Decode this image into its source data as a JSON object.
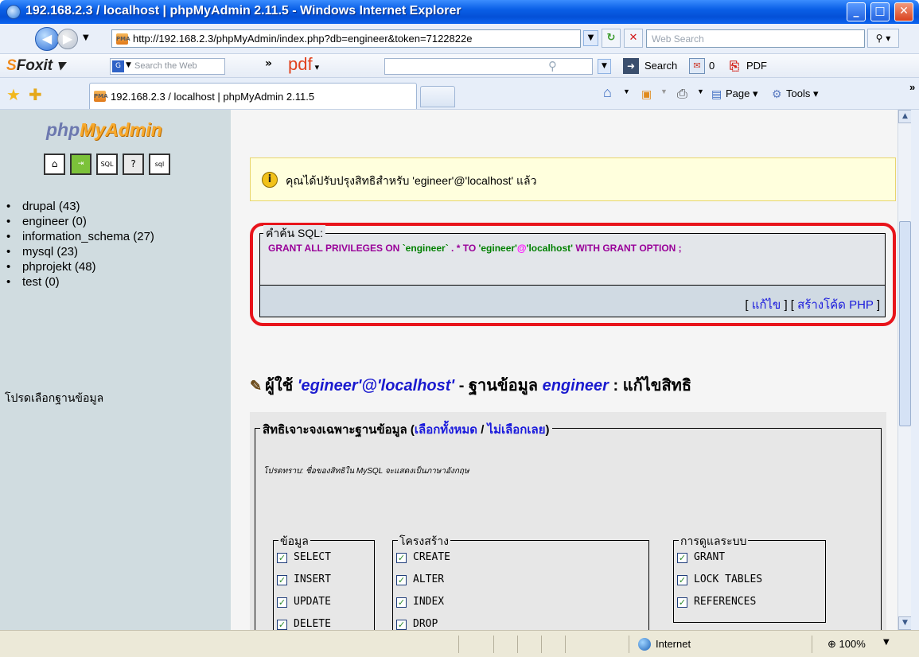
{
  "window": {
    "title": "192.168.2.3 / localhost | phpMyAdmin 2.11.5 - Windows Internet Explorer"
  },
  "address": {
    "url": "http://192.168.2.3/phpMyAdmin/index.php?db=engineer&token=7122822e",
    "search_placeholder": "Web Search"
  },
  "foxit": {
    "logo": "Foxit",
    "search_placeholder": "Search the Web",
    "pdf_word": "pdf",
    "search_label": "Search",
    "count": "0",
    "pdf_label": "PDF"
  },
  "tabs": {
    "active_label": "192.168.2.3 / localhost | phpMyAdmin 2.11.5",
    "page_label": "Page",
    "tools_label": "Tools"
  },
  "sidebar": {
    "logo_a": "php",
    "logo_b": "MyAdmin",
    "databases": [
      "drupal (43)",
      "engineer (0)",
      "information_schema (27)",
      "mysql (23)",
      "phprojekt (48)",
      "test (0)"
    ],
    "hint": "โปรดเลือกฐานข้อมูล"
  },
  "notice": {
    "text": "คุณได้ปรับปรุงสิทธิสำหรับ 'egineer'@'localhost' แล้ว"
  },
  "sql": {
    "legend": "คำค้น SQL:",
    "parts": {
      "grant": "GRANT ALL PRIVILEGES ON ",
      "db": "`engineer`",
      "dot": " . * ",
      "to": "TO ",
      "user": "'egineer'",
      "at": "@",
      "host": "'localhost'",
      "tail": " WITH GRANT OPTION ;"
    },
    "edit_link": "แก้ไข",
    "php_link": "สร้างโค้ด PHP"
  },
  "heading": {
    "prefix": "ผู้ใช้ ",
    "user": "'egineer'@'localhost'",
    "mid": " - ฐานข้อมูล ",
    "db": "engineer",
    "suffix": " : แก้ไขสิทธิ"
  },
  "privileges": {
    "legend": "สิทธิเจาะจงเฉพาะฐานข้อมูล",
    "check_all": "เลือกทั้งหมด",
    "sep": " / ",
    "uncheck_all": "ไม่เลือกเลย",
    "note": "โปรดทราบ: ชื่อของสิทธิใน MySQL จะแสดงเป็นภาษาอังกฤษ",
    "groups": {
      "data": {
        "label": "ข้อมูล",
        "items": [
          "SELECT",
          "INSERT",
          "UPDATE",
          "DELETE"
        ]
      },
      "structure": {
        "label": "โครงสร้าง",
        "items": [
          "CREATE",
          "ALTER",
          "INDEX",
          "DROP"
        ]
      },
      "admin": {
        "label": "การดูแลระบบ",
        "items": [
          "GRANT",
          "LOCK TABLES",
          "REFERENCES"
        ]
      }
    }
  },
  "status": {
    "zone": "Internet",
    "zoom": "100%"
  }
}
